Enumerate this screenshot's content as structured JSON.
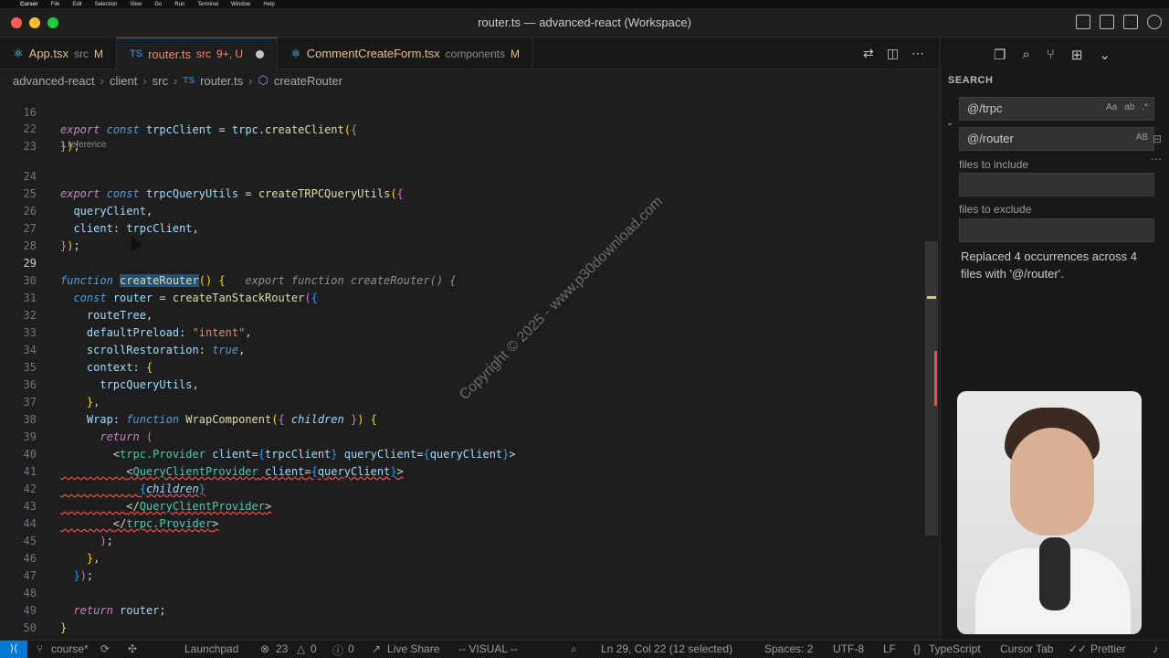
{
  "menubar": {
    "app": "Cursor",
    "items": [
      "File",
      "Edit",
      "Selection",
      "View",
      "Go",
      "Run",
      "Terminal",
      "Window",
      "Help"
    ]
  },
  "window": {
    "title": "router.ts — advanced-react (Workspace)"
  },
  "tabs": [
    {
      "label": "App.tsx",
      "desc": "src",
      "status": "M"
    },
    {
      "label": "router.ts",
      "desc": "src",
      "status": "9+, U"
    },
    {
      "label": "CommentCreateForm.tsx",
      "desc": "components",
      "status": "M"
    }
  ],
  "breadcrumb": [
    "advanced-react",
    "client",
    "src",
    "router.ts",
    "createRouter"
  ],
  "editor": {
    "codelens": "1 reference",
    "ghost_text": "export function createRouter() {",
    "line_numbers": [
      "16",
      "22",
      "23",
      "",
      "24",
      "25",
      "26",
      "27",
      "28",
      "29",
      "30",
      "31",
      "32",
      "33",
      "34",
      "35",
      "36",
      "37",
      "38",
      "39",
      "40",
      "41",
      "42",
      "43",
      "44",
      "45",
      "46",
      "47",
      "48",
      "49",
      "50"
    ]
  },
  "search": {
    "title": "SEARCH",
    "query": "@/trpc",
    "replace": "@/router",
    "query_opts": [
      "Aa",
      "ab",
      ".*"
    ],
    "replace_opts": [
      "AB"
    ],
    "include_label": "files to include",
    "exclude_label": "files to exclude",
    "result": "Replaced 4 occurrences across 4 files with '@/router'."
  },
  "watermark": "Copyright © 2025 - www.p30download.com",
  "statusbar": {
    "remote": "⟩⟨",
    "branch": "course*",
    "launchpad": "Launchpad",
    "errors": "23",
    "warnings": "0",
    "info": "0",
    "liveshare": "Live Share",
    "mode": "-- VISUAL --",
    "position": "Ln 29, Col 22 (12 selected)",
    "spaces": "Spaces: 2",
    "encoding": "UTF-8",
    "eol": "LF",
    "language": "TypeScript",
    "cursor_tab": "Cursor Tab",
    "prettier": "Prettier"
  }
}
